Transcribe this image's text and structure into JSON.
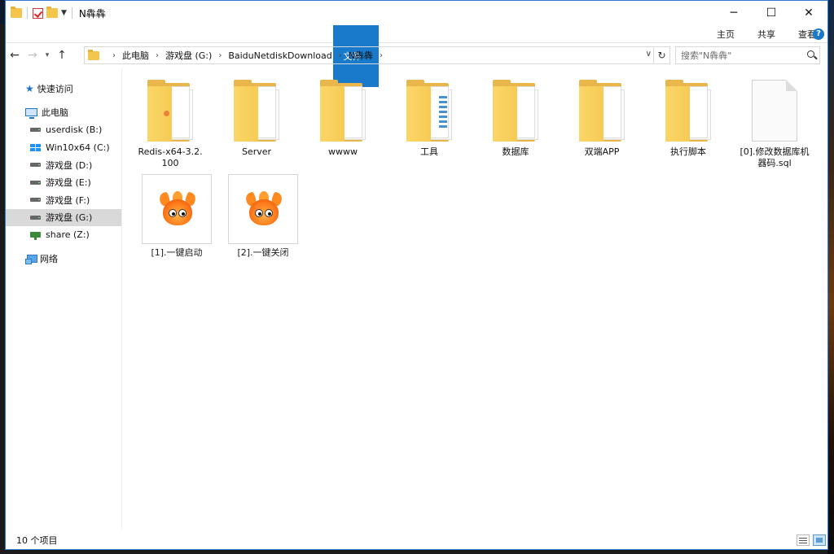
{
  "window": {
    "title": "N犇犇"
  },
  "ribbon": {
    "tabs": [
      "文件",
      "主页",
      "共享",
      "查看"
    ]
  },
  "address": {
    "crumbs": [
      "此电脑",
      "游戏盘 (G:)",
      "BaiduNetdiskDownload",
      "N犇犇"
    ],
    "search_placeholder": "搜索\"N犇犇\""
  },
  "sidebar": {
    "quick_access": "快速访问",
    "this_pc": "此电脑",
    "drives": [
      "userdisk (B:)",
      "Win10x64 (C:)",
      "游戏盘 (D:)",
      "游戏盘 (E:)",
      "游戏盘 (F:)",
      "游戏盘 (G:)",
      "share (Z:)"
    ],
    "network": "网络"
  },
  "files": [
    {
      "name": "Redis-x64-3.2.100",
      "type": "folder"
    },
    {
      "name": "Server",
      "type": "folder"
    },
    {
      "name": "wwww",
      "type": "folder"
    },
    {
      "name": "工具",
      "type": "folder"
    },
    {
      "name": "数据库",
      "type": "folder"
    },
    {
      "name": "双端APP",
      "type": "folder"
    },
    {
      "name": "执行脚本",
      "type": "folder"
    },
    {
      "name": "[0].修改数据库机器码.sql",
      "type": "file"
    },
    {
      "name": "[1].一键启动",
      "type": "exe"
    },
    {
      "name": "[2].一键关闭",
      "type": "exe"
    }
  ],
  "status": {
    "count": "10 个项目"
  },
  "colors": {
    "accent": "#1979ca",
    "folder": "#f6cb55",
    "selected": "#d9d9d9"
  }
}
